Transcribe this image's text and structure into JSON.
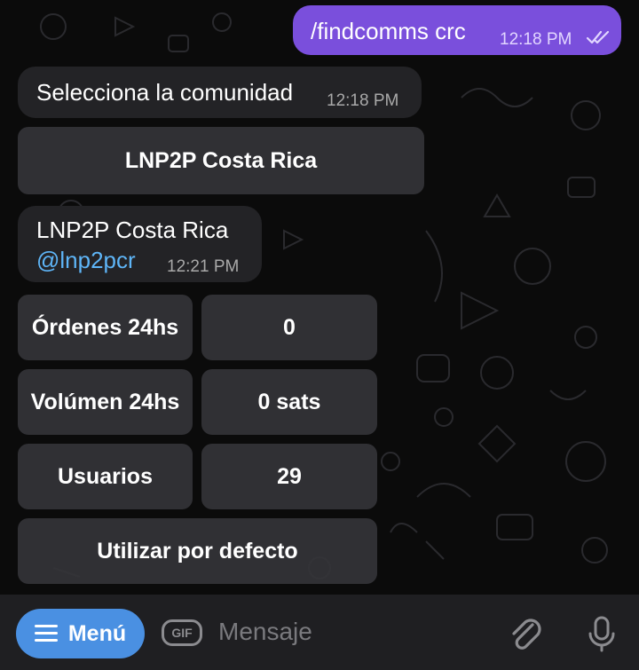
{
  "chat": {
    "outgoing": {
      "text": "/findcomms crc",
      "time": "12:18 PM"
    },
    "incoming1": {
      "text": "Selecciona la comunidad",
      "time": "12:18 PM"
    },
    "community_button": "LNP2P Costa Rica",
    "incoming2": {
      "title": "LNP2P Costa Rica",
      "handle": "@lnp2pcr",
      "time": "12:21 PM"
    },
    "stats": [
      {
        "label": "Órdenes 24hs",
        "value": "0"
      },
      {
        "label": "Volúmen 24hs",
        "value": "0 sats"
      },
      {
        "label": "Usuarios",
        "value": "29"
      }
    ],
    "default_button": "Utilizar por defecto"
  },
  "input": {
    "menu_label": "Menú",
    "gif_label": "GIF",
    "placeholder": "Mensaje"
  },
  "icons": [
    "menu-icon",
    "gif-icon",
    "attach-icon",
    "microphone-icon",
    "double-check-icon"
  ],
  "colors": {
    "outgoing": "#7a4fdc",
    "link": "#5eb5f7",
    "menu": "#4a90e2"
  }
}
